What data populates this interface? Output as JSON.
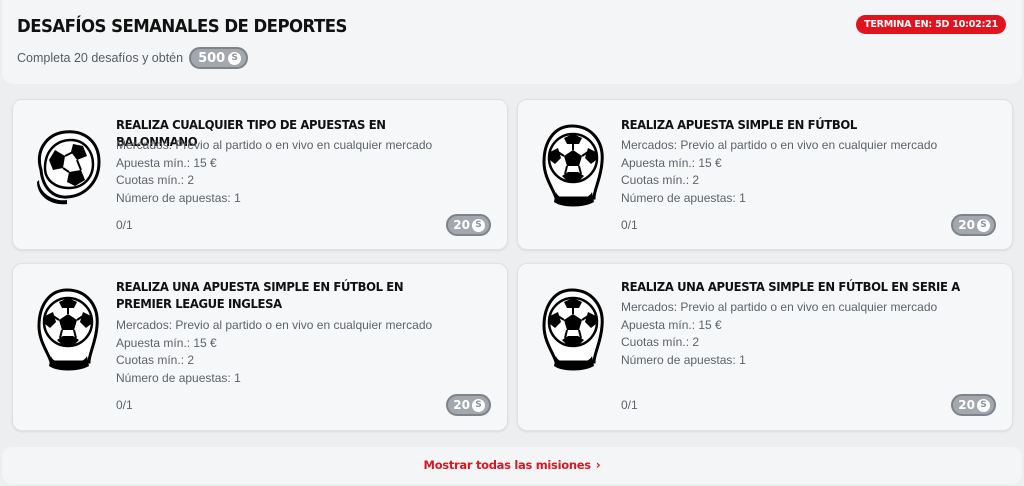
{
  "header": {
    "title": "DESAFÍOS SEMANALES DE DEPORTES",
    "subtitle": "Completa 20 desafíos y obtén",
    "points": "500",
    "timer": "TERMINA EN: 5D 10:02:21"
  },
  "coin_symbol": "S",
  "cards": [
    {
      "title": "REALIZA CUALQUIER TIPO DE APUESTAS EN BALONMANO",
      "markets": "Mercados: Previo al partido o en vivo en cualquier mercado",
      "min_stake": "Apuesta mín.: 15 €",
      "min_odds": "Cuotas mín.: 2",
      "num_bets": "Número de apuestas: 1",
      "progress": "0/1",
      "reward": "20",
      "icon": "handball-icon"
    },
    {
      "title": "REALIZA APUESTA SIMPLE EN FÚTBOL",
      "markets": "Mercados: Previo al partido o en vivo en cualquier mercado",
      "min_stake": "Apuesta mín.: 15 €",
      "min_odds": "Cuotas mín.: 2",
      "num_bets": "Número de apuestas: 1",
      "progress": "0/1",
      "reward": "20",
      "icon": "football-icon"
    },
    {
      "title": "REALIZA UNA APUESTA SIMPLE EN FÚTBOL EN PREMIER LEAGUE INGLESA",
      "markets": "Mercados: Previo al partido o en vivo en cualquier mercado",
      "min_stake": "Apuesta mín.: 15 €",
      "min_odds": "Cuotas mín.: 2",
      "num_bets": "Número de apuestas: 1",
      "progress": "0/1",
      "reward": "20",
      "icon": "football-icon"
    },
    {
      "title": "REALIZA UNA APUESTA SIMPLE EN FÚTBOL EN SERIE A",
      "markets": "Mercados: Previo al partido o en vivo en cualquier mercado",
      "min_stake": "Apuesta mín.: 15 €",
      "min_odds": "Cuotas mín.: 2",
      "num_bets": "Número de apuestas: 1",
      "progress": "0/1",
      "reward": "20",
      "icon": "football-icon"
    }
  ],
  "footer": {
    "show_all": "Mostrar todas las misiones"
  }
}
